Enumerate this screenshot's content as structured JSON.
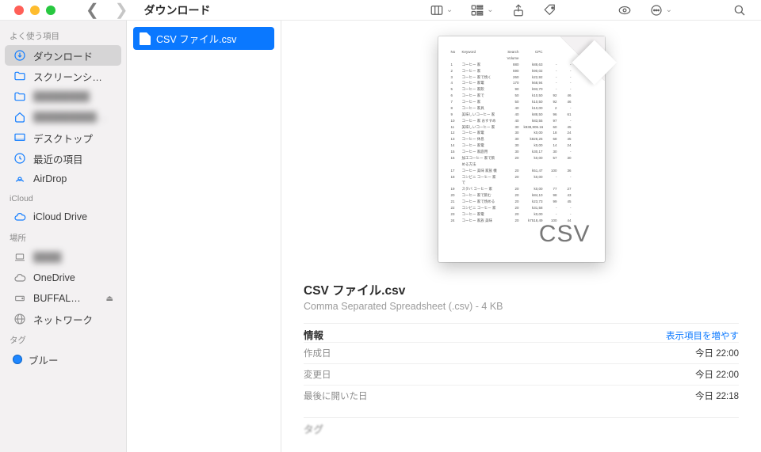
{
  "window": {
    "title": "ダウンロード"
  },
  "sidebar": {
    "favorites_label": "よく使う項目",
    "icloud_label": "iCloud",
    "locations_label": "場所",
    "tags_label": "タグ",
    "favorites": [
      {
        "icon": "download",
        "label": "ダウンロード",
        "selected": true
      },
      {
        "icon": "folder",
        "label": "スクリーンシ…"
      },
      {
        "icon": "folder",
        "label": "████████",
        "blur": true
      },
      {
        "icon": "home",
        "label": "█████████████",
        "blur": true
      },
      {
        "icon": "desktop",
        "label": "デスクトップ"
      },
      {
        "icon": "clock",
        "label": "最近の項目"
      },
      {
        "icon": "airdrop",
        "label": "AirDrop"
      }
    ],
    "icloud": [
      {
        "icon": "cloud",
        "label": "iCloud Drive"
      }
    ],
    "locations": [
      {
        "icon": "laptop",
        "label": "████",
        "blur": true
      },
      {
        "icon": "cloud",
        "label": "OneDrive"
      },
      {
        "icon": "disk",
        "label": "BUFFAL…",
        "eject": true
      },
      {
        "icon": "globe",
        "label": "ネットワーク"
      }
    ],
    "tags": [
      {
        "label": "ブルー",
        "color": "#1f87ff"
      }
    ]
  },
  "file": {
    "name": "CSV ファイル.csv",
    "subtitle": "Comma Separated Spreadsheet (.csv) - 4 KB",
    "info_label": "情報",
    "more_label": "表示項目を増やす",
    "tags_section": "タグ",
    "meta": [
      {
        "k": "作成日",
        "v": "今日 22:00"
      },
      {
        "k": "変更日",
        "v": "今日 22:00"
      },
      {
        "k": "最後に開いた日",
        "v": "今日 22:18"
      }
    ],
    "csv_badge": "CSV"
  },
  "thumb_rows": [
    [
      "No",
      "Keyword",
      "Search Volume",
      "CPC",
      "",
      ""
    ],
    [
      "1",
      "コーヒー 家",
      "880",
      "k88,63",
      "-",
      "-"
    ],
    [
      "2",
      "コーヒー 家",
      "590",
      "k90,02",
      "-",
      "-"
    ],
    [
      "3",
      "コーヒー 家で焼く",
      "260",
      "k22,92",
      "-",
      "-"
    ],
    [
      "4",
      "コーヒー 家電",
      "170",
      "k68,94",
      "-",
      "-"
    ],
    [
      "5",
      "コーヒー 家飲",
      "90",
      "k93,70",
      "-",
      "-"
    ],
    [
      "6",
      "コーヒー 家で",
      "50",
      "k10,50",
      "92",
      "46"
    ],
    [
      "7",
      "コーヒー 家",
      "50",
      "k10,50",
      "92",
      "46"
    ],
    [
      "8",
      "コーヒー 家具",
      "40",
      "k10,00",
      "2",
      "-"
    ],
    [
      "9",
      "美味しいコーヒー 家",
      "40",
      "k88,50",
      "96",
      "61"
    ],
    [
      "10",
      "コーヒー 家 おすすめ",
      "40",
      "k83,55",
      "97",
      "-"
    ],
    [
      "11",
      "美味しいコーヒー 家",
      "30",
      "k938,906.16",
      "60",
      "45"
    ],
    [
      "12",
      "コーヒー 家電",
      "30",
      "k0,00",
      "18",
      "24"
    ],
    [
      "13",
      "コーヒー 休息",
      "30",
      "k828,25",
      "68",
      "45"
    ],
    [
      "14",
      "コーヒー 家電",
      "30",
      "k0,00",
      "14",
      "24"
    ],
    [
      "15",
      "コーヒー 家庭用",
      "30",
      "k30,17",
      "30",
      "-"
    ],
    [
      "16",
      "加工コーヒー 家で飲める方法",
      "20",
      "k0,00",
      "57",
      "30"
    ],
    [
      "17",
      "コーヒー 美味 家族 機",
      "20",
      "k51,47",
      "100",
      "36"
    ],
    [
      "18",
      "コンビニ コーヒー 家で",
      "20",
      "k0,00",
      "-",
      "-"
    ],
    [
      "19",
      "スタバ コーヒー 家",
      "20",
      "k0,00",
      "77",
      "27"
    ],
    [
      "20",
      "コーヒー 家で飲む",
      "20",
      "k84,10",
      "98",
      "43"
    ],
    [
      "21",
      "コーヒー 家で焼める",
      "20",
      "k23,73",
      "99",
      "45"
    ],
    [
      "22",
      "コンビニ コーヒー 家",
      "20",
      "k31,58",
      "-",
      "-"
    ],
    [
      "23",
      "コーヒー 家電",
      "20",
      "k0,00",
      "-",
      "-"
    ],
    [
      "24",
      "コーヒー 家族 美味",
      "20",
      "k7518,49",
      "100",
      "44"
    ]
  ]
}
